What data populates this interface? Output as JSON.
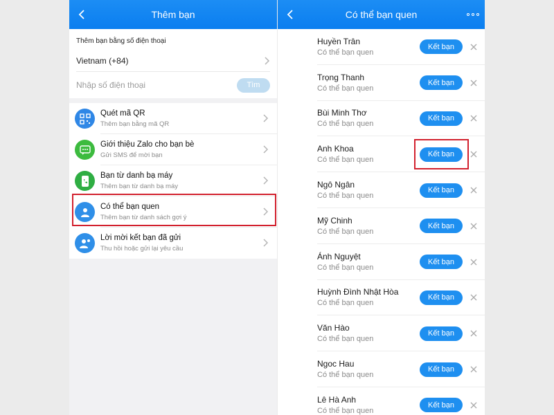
{
  "left": {
    "title": "Thêm bạn",
    "phone_heading": "Thêm bạn bằng số điện thoại",
    "country": "Vietnam (+84)",
    "phone_placeholder": "Nhập số điện thoại",
    "find_label": "Tìm",
    "menu": [
      {
        "title": "Quét mã QR",
        "subtitle": "Thêm bạn bằng mã QR",
        "icon": "qr-code-icon",
        "color": "#2f87e6"
      },
      {
        "title": "Giới thiệu Zalo cho bạn bè",
        "subtitle": "Gửi SMS để mời bạn",
        "icon": "sms-chat-icon",
        "color": "#3dbb3f"
      },
      {
        "title": "Bạn từ danh bạ máy",
        "subtitle": "Thêm bạn từ danh bạ máy",
        "icon": "phone-contact-icon",
        "color": "#2fae43"
      },
      {
        "title": "Có thể bạn quen",
        "subtitle": "Thêm bạn từ danh sách gợi ý",
        "icon": "person-suggest-icon",
        "color": "#2f8fe8"
      },
      {
        "title": "Lời mời kết bạn đã gửi",
        "subtitle": "Thu hồi hoặc gửi lại yêu cầu",
        "icon": "person-sent-icon",
        "color": "#2f8fe8"
      }
    ]
  },
  "right": {
    "title": "Có thể bạn quen",
    "add_label": "Kết bạn",
    "friends": [
      {
        "name": "Huyền Trân",
        "subtitle": "Có thể bạn quen"
      },
      {
        "name": "Trọng Thanh",
        "subtitle": "Có thể bạn quen"
      },
      {
        "name": "Bùi Minh Thơ",
        "subtitle": "Có thể bạn quen"
      },
      {
        "name": "Anh Khoa",
        "subtitle": "Có thể bạn quen"
      },
      {
        "name": "Ngô Ngân",
        "subtitle": "Có thể bạn quen"
      },
      {
        "name": "Mỹ Chinh",
        "subtitle": "Có thể bạn quen"
      },
      {
        "name": "Ánh Nguyệt",
        "subtitle": "Có thể bạn quen"
      },
      {
        "name": "Huỳnh Đình Nhật Hòa",
        "subtitle": "Có thể bạn quen"
      },
      {
        "name": "Văn Hào",
        "subtitle": "Có thể bạn quen"
      },
      {
        "name": "Ngoc Hau",
        "subtitle": "Có thể bạn quen"
      },
      {
        "name": "Lê Hà Anh",
        "subtitle": "Có thể bạn quen"
      }
    ]
  },
  "colors": {
    "nav": "#0a7ef0",
    "button": "#1e8ff0",
    "highlight": "#d2202d"
  }
}
